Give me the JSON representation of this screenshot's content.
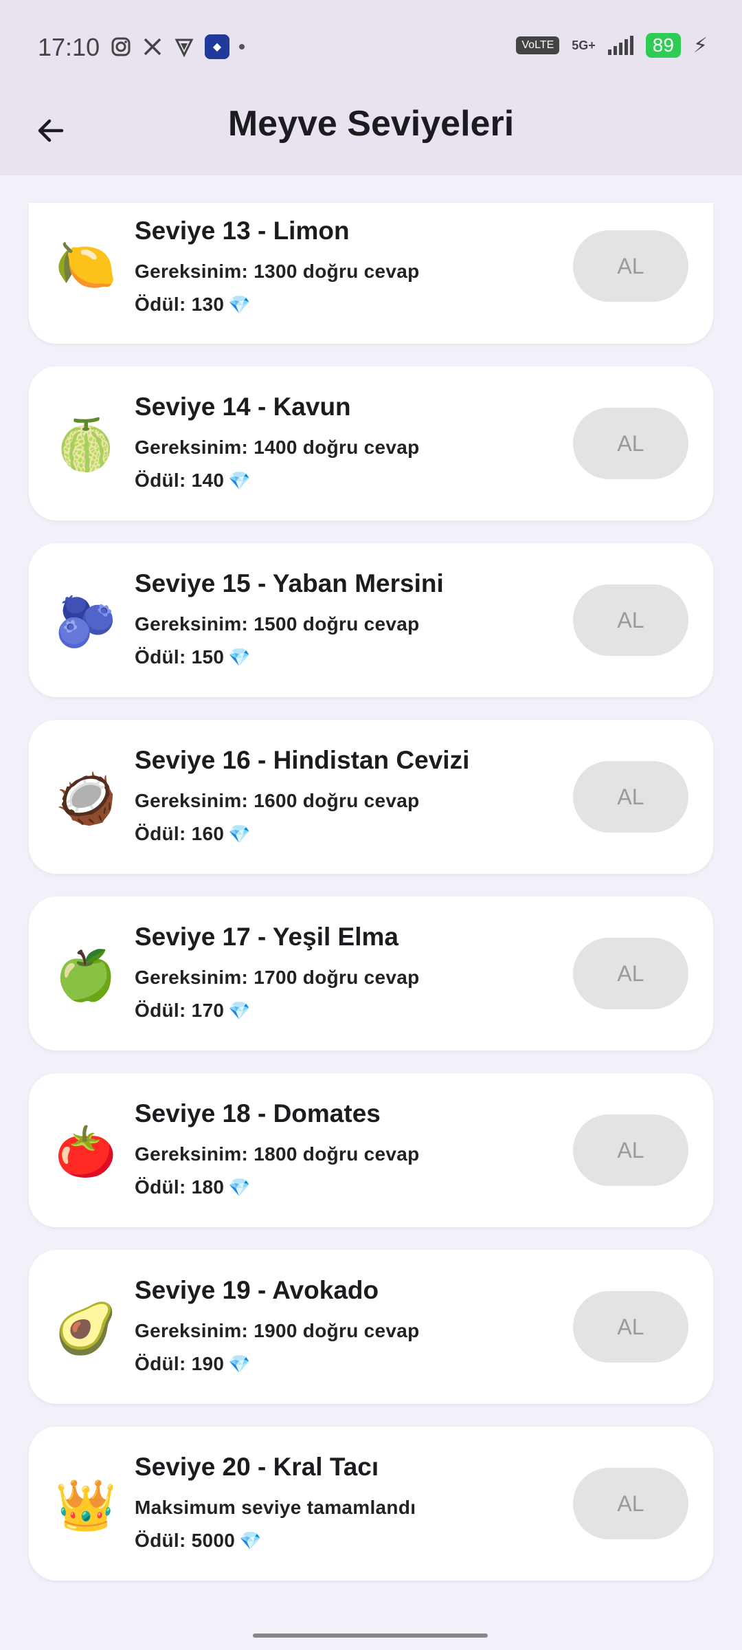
{
  "status_bar": {
    "time": "17:10",
    "battery": "89",
    "volte": "VoLTE",
    "network": "5G+"
  },
  "header": {
    "title": "Meyve Seviyeleri"
  },
  "levels": [
    {
      "title": "Seviye 13 - Limon",
      "requirement": "Gereksinim: 1300 doğru cevap",
      "reward": "Ödül: 130",
      "emoji": "🍋",
      "button": "AL"
    },
    {
      "title": "Seviye 14 - Kavun",
      "requirement": "Gereksinim: 1400 doğru cevap",
      "reward": "Ödül: 140",
      "emoji": "🍈",
      "button": "AL"
    },
    {
      "title": "Seviye 15 - Yaban Mersini",
      "requirement": "Gereksinim: 1500 doğru cevap",
      "reward": "Ödül: 150",
      "emoji": "🫐",
      "button": "AL"
    },
    {
      "title": "Seviye 16 - Hindistan Cevizi",
      "requirement": "Gereksinim: 1600 doğru cevap",
      "reward": "Ödül: 160",
      "emoji": "🥥",
      "button": "AL"
    },
    {
      "title": "Seviye 17 - Yeşil Elma",
      "requirement": "Gereksinim: 1700 doğru cevap",
      "reward": "Ödül: 170",
      "emoji": "🍏",
      "button": "AL"
    },
    {
      "title": "Seviye 18 - Domates",
      "requirement": "Gereksinim: 1800 doğru cevap",
      "reward": "Ödül: 180",
      "emoji": "🍅",
      "button": "AL"
    },
    {
      "title": "Seviye 19 - Avokado",
      "requirement": "Gereksinim: 1900 doğru cevap",
      "reward": "Ödül: 190",
      "emoji": "🥑",
      "button": "AL"
    },
    {
      "title": "Seviye 20 - Kral Tacı",
      "requirement": "Maksimum seviye tamamlandı",
      "reward": "Ödül: 5000",
      "emoji": "👑",
      "button": "AL"
    }
  ],
  "gem_icon": "💎",
  "colors": {
    "header_bg": "#E8E3EE",
    "page_bg": "#F3F0FA",
    "button_bg": "#E3E3E3",
    "button_text": "#9a9a9a"
  }
}
